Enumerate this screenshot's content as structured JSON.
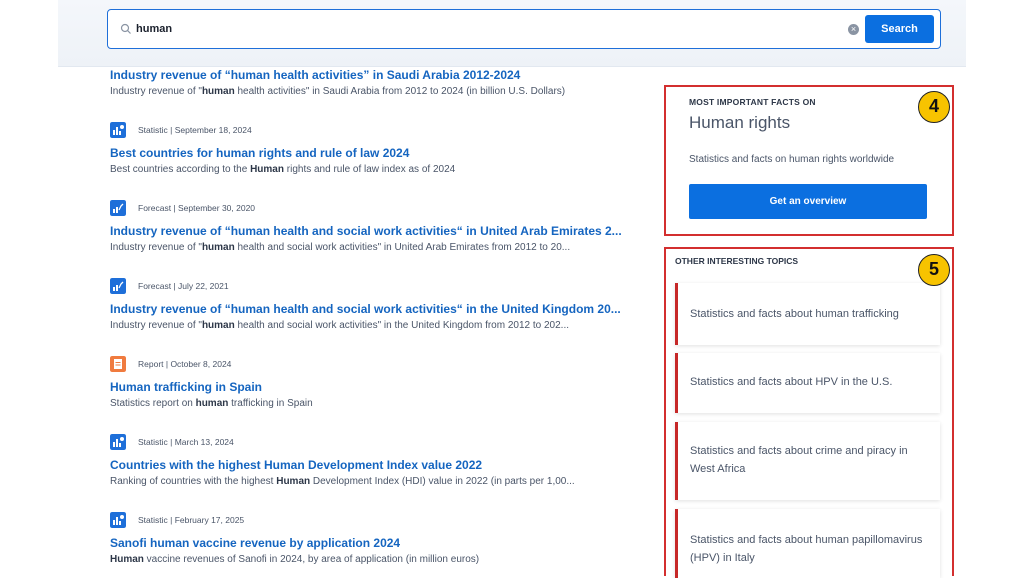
{
  "search": {
    "value": "human",
    "button_label": "Search"
  },
  "results": [
    {
      "meta": "",
      "title": "Industry revenue of “human health activities” in Saudi Arabia 2012-2024",
      "desc_before": "Industry revenue of \"",
      "desc_bold": "human",
      "desc_after": " health activities\" in Saudi Arabia from 2012 to 2024 (in billion U.S. Dollars)"
    },
    {
      "type": "statistic",
      "meta": "Statistic | September 18, 2024",
      "title": "Best countries for human rights and rule of law 2024",
      "desc_before": "Best countries according to the ",
      "desc_bold": "Human",
      "desc_after": " rights and rule of law index as of 2024"
    },
    {
      "type": "forecast",
      "meta": "Forecast | September 30, 2020",
      "title": "Industry revenue of “human health and social work activities“ in United Arab Emirates 2...",
      "desc_before": "Industry revenue of \"",
      "desc_bold": "human",
      "desc_after": " health and social work activities\" in United Arab Emirates from 2012 to 20..."
    },
    {
      "type": "forecast",
      "meta": "Forecast | July 22, 2021",
      "title": "Industry revenue of “human health and social work activities“ in the United Kingdom 20...",
      "desc_before": "Industry revenue of \"",
      "desc_bold": "human",
      "desc_after": " health and social work activities\" in the United Kingdom from 2012 to 202..."
    },
    {
      "type": "report",
      "meta": "Report | October 8, 2024",
      "title": "Human trafficking in Spain",
      "desc_before": "Statistics report on ",
      "desc_bold": "human",
      "desc_after": " trafficking in Spain"
    },
    {
      "type": "statistic",
      "meta": "Statistic | March 13, 2024",
      "title": "Countries with the highest Human Development Index value 2022",
      "desc_before": "Ranking of countries with the highest ",
      "desc_bold": "Human",
      "desc_after": " Development Index (HDI) value in 2022 (in parts per 1,00..."
    },
    {
      "type": "statistic",
      "meta": "Statistic | February 17, 2025",
      "title": "Sanofi human vaccine revenue by application 2024",
      "desc_before": "",
      "desc_bold": "Human",
      "desc_after": " vaccine revenues of Sanofi in 2024, by area of application (in million euros)"
    }
  ],
  "facts": {
    "kicker": "MOST IMPORTANT FACTS ON",
    "heading": "Human rights",
    "description": "Statistics and facts on human rights worldwide",
    "button_label": "Get an overview",
    "badge": "4"
  },
  "topics": {
    "kicker": "OTHER INTERESTING TOPICS",
    "badge": "5",
    "items": [
      "Statistics and facts about human trafficking",
      "Statistics and facts about HPV in the U.S.",
      "Statistics and facts about crime and piracy in West Africa",
      "Statistics and facts about human papillomavirus (HPV) in Italy"
    ]
  },
  "colors": {
    "accent": "#0b6fe0",
    "link": "#1565c0",
    "highlight_border": "#d32f2f",
    "badge": "#f7c300"
  }
}
